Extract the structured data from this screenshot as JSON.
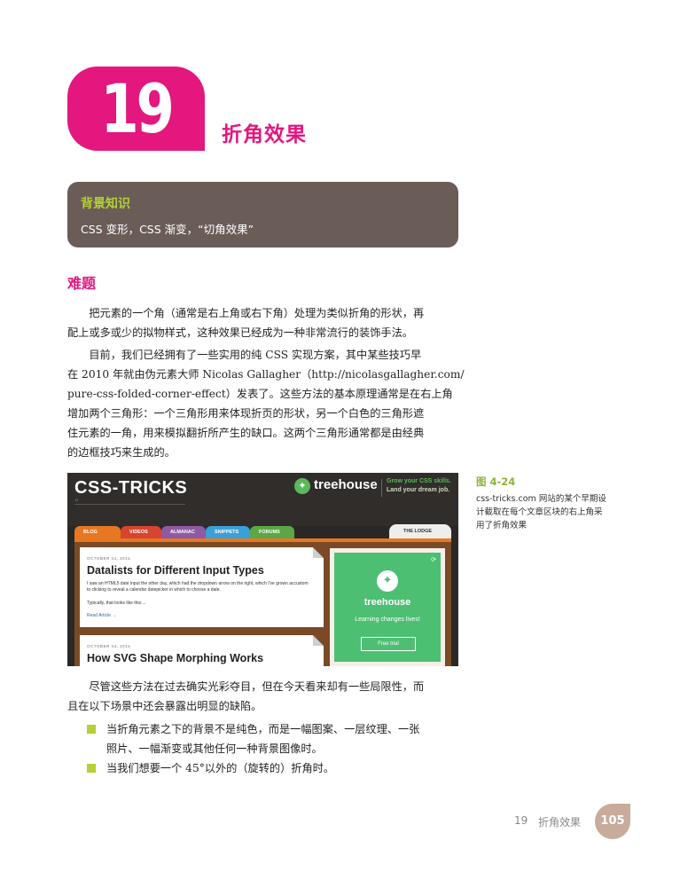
{
  "chapter": {
    "number": "19",
    "title": "折角效果"
  },
  "background_box": {
    "title": "背景知识",
    "body": "CSS 变形，CSS 渐变，“切角效果”"
  },
  "section": {
    "heading": "难题"
  },
  "paragraphs": [
    {
      "lines": [
        "　　把元素的一个角（通常是右上角或右下角）处理为类似折角的形状，再",
        "配上或多或少的拟物样式，这种效果已经成为一种非常流行的装饰手法。"
      ]
    },
    {
      "lines": [
        "　　目前，我们已经拥有了一些实用的纯 CSS 实现方案，其中某些技巧早",
        "在 2010 年就由伪元素大师 Nicolas Gallagher（http://nicolasgallagher.com/",
        "pure-css-folded-corner-effect）发表了。这些方法的基本原理通常是在右上角",
        "增加两个三角形：一个三角形用来体现折页的形状，另一个白色的三角形遮",
        "住元素的一角，用来模拟翻折所产生的缺口。这两个三角形通常都是由经典",
        "的边框技巧来生成的。"
      ]
    },
    {
      "lines": [
        "　　尽管这些方法在过去确实光彩夺目，但在今天看来却有一些局限性，而",
        "且在以下场景中还会暴露出明显的缺陷。"
      ]
    }
  ],
  "figure": {
    "logo": "CSS-TRICKS",
    "treehouse": {
      "word": "treehouse",
      "tag_line1": "Grow your CSS skills.",
      "tag_line2": "Land your dream job."
    },
    "nav": [
      "BLOG",
      "VIDEOS",
      "ALMANAC",
      "SNIPPETS",
      "FORUMS"
    ],
    "nav_colors": [
      "#e87722",
      "#d6452f",
      "#8e5aa6",
      "#3aa0d8",
      "#5aa845"
    ],
    "lodge": "THE LODGE",
    "card1": {
      "date": "OCTOBER 24, 2014",
      "title": "Datalists for Different Input Types",
      "text1": "I saw an HTML5 date input the other day, which had the dropdown arrow on the right, which I've grown accustom to clicking to reveal a calendar datepicker in which to choose a date.",
      "text2": "Typically, that looks like this:...",
      "link": "Read Article →"
    },
    "card2": {
      "date": "OCTOBER 24, 2014",
      "title": "How SVG Shape Morphing Works"
    },
    "ad": {
      "word": "treehouse",
      "tagline": "Learning changes lives!",
      "button": "Free trial"
    }
  },
  "caption": {
    "number": "图 4-24",
    "text": "css-tricks.com 网站的某个早期设计截取在每个文章区块的右上角采用了折角效果"
  },
  "caption_lines": [
    "css-tricks.com 网站的某个早期设",
    "计截取在每个文章区块的右上角采",
    "用了折角效果"
  ],
  "bullets": [
    {
      "lines": [
        "当折角元素之下的背景不是纯色，而是一幅图案、一层纹理、一张",
        "照片、一幅渐变或其他任何一种背景图像时。"
      ]
    },
    {
      "lines": [
        "当我们想要一个 45°以外的（旋转的）折角时。"
      ]
    }
  ],
  "footer": {
    "chapter": "19",
    "title": "折角效果",
    "page": "105"
  }
}
